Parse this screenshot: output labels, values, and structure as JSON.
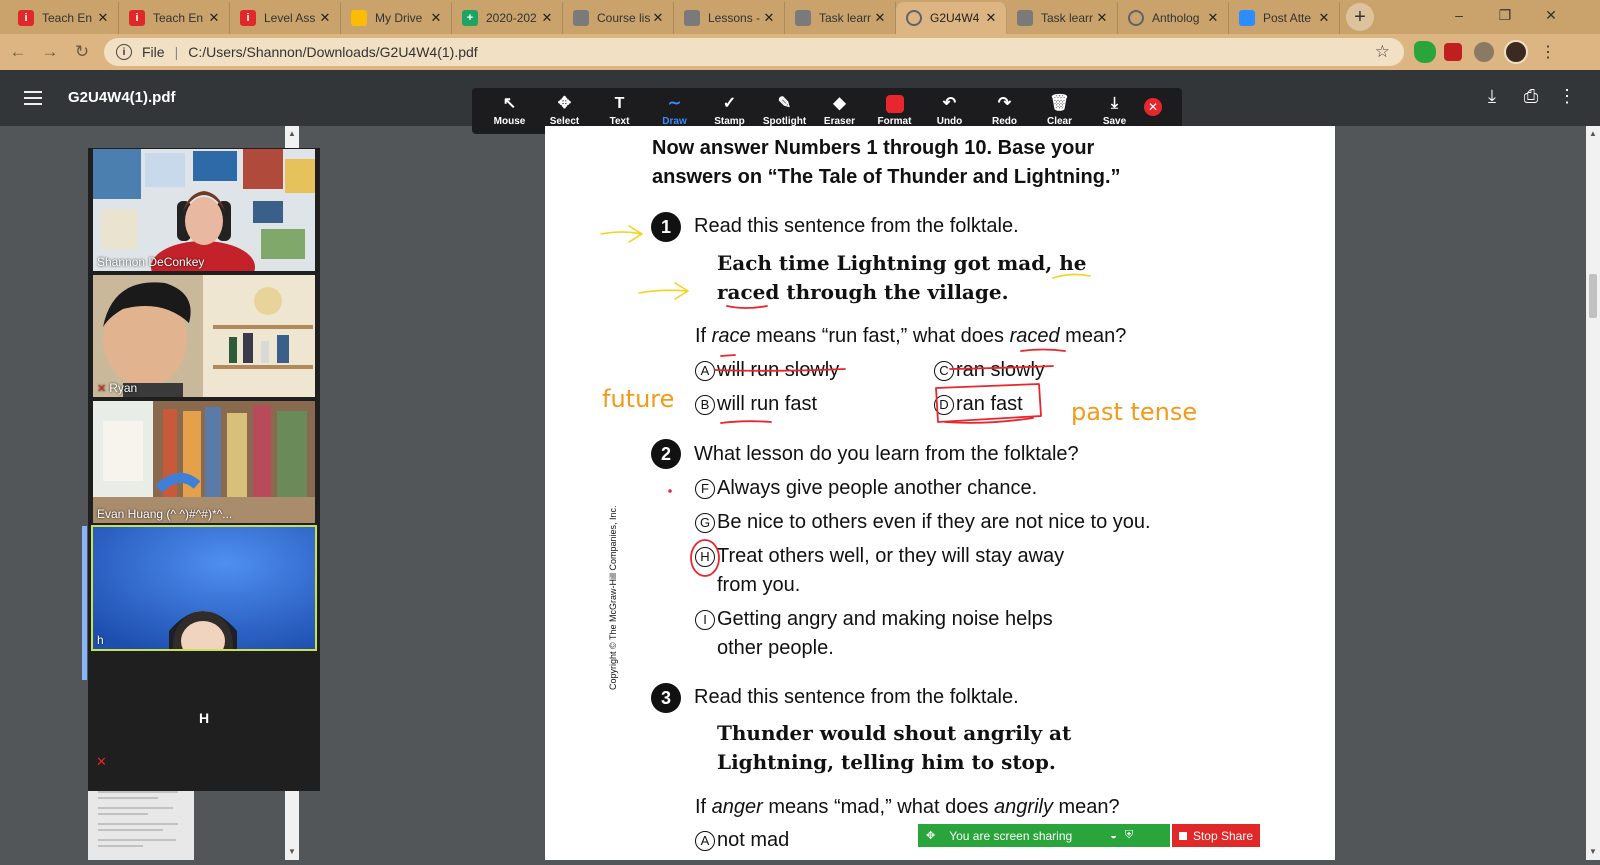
{
  "browser": {
    "tabs": [
      {
        "label": "Teach En",
        "icon": "i",
        "color": "#e02828"
      },
      {
        "label": "Teach En",
        "icon": "i",
        "color": "#e02828"
      },
      {
        "label": "Level Ass",
        "icon": "i",
        "color": "#e02828"
      },
      {
        "label": "My Drive",
        "icon": "drive",
        "color": "#fbbc04"
      },
      {
        "label": "2020-202",
        "icon": "+",
        "color": "#1ea362"
      },
      {
        "label": "Course lis",
        "icon": "course",
        "color": "#7a7a7a"
      },
      {
        "label": "Lessons -",
        "icon": "course",
        "color": "#7a7a7a"
      },
      {
        "label": "Task learr",
        "icon": "course",
        "color": "#7a7a7a"
      },
      {
        "label": "G2U4W4",
        "icon": "globe",
        "color": "#5f6368"
      },
      {
        "label": "Task learr",
        "icon": "course",
        "color": "#7a7a7a"
      },
      {
        "label": "Antholog",
        "icon": "globe",
        "color": "#5f6368"
      },
      {
        "label": "Post Atte",
        "icon": "zoom",
        "color": "#2d8cff"
      }
    ],
    "active_tab": 8,
    "tab_close": "✕",
    "new_tab": "+",
    "window_controls": [
      "–",
      "❐",
      "✕"
    ],
    "address": {
      "scheme": "File",
      "url": "C:/Users/Shannon/Downloads/G2U4W4(1).pdf"
    }
  },
  "pdf_viewer": {
    "title": "G2U4W4(1).pdf"
  },
  "annotation_toolbar": {
    "tools": [
      {
        "label": "Mouse",
        "icon": "↖"
      },
      {
        "label": "Select",
        "icon": "✥"
      },
      {
        "label": "Text",
        "icon": "T"
      },
      {
        "label": "Draw",
        "icon": "∼"
      },
      {
        "label": "Stamp",
        "icon": "✓"
      },
      {
        "label": "Spotlight",
        "icon": "✎"
      },
      {
        "label": "Eraser",
        "icon": "◆"
      },
      {
        "label": "Format",
        "icon": "■"
      },
      {
        "label": "Undo",
        "icon": "↶"
      },
      {
        "label": "Redo",
        "icon": "↷"
      },
      {
        "label": "Clear",
        "icon": "🗑"
      },
      {
        "label": "Save",
        "icon": "⤓"
      }
    ],
    "active_tool": "Draw",
    "format_color": "#e8262d"
  },
  "zoom_panel": {
    "participants": [
      {
        "name": "Shannon DeConkey",
        "muted": false
      },
      {
        "name": "Ryan",
        "muted": true
      },
      {
        "name": "Evan Huang (^ ^)#^#)*^...",
        "muted": false
      },
      {
        "name": "h",
        "muted": false
      }
    ],
    "placeholder_name": "H"
  },
  "document": {
    "heading_line1": "Now answer Numbers 1 through 10. Base your",
    "heading_line2": "answers on “The Tale of Thunder and Lightning.”",
    "q1": {
      "number": "1",
      "prompt": "Read this sentence from the folktale.",
      "quote_line1a": "Each time Lightning got mad, ",
      "quote_line1b": "he",
      "quote_line2a": "raced",
      "quote_line2b": " through the village.",
      "question": {
        "pre": "If ",
        "w1": "race",
        "mid": " means “run fast,” what does ",
        "w2": "raced",
        "post": " mean?"
      },
      "options": [
        {
          "letter": "A",
          "text": "will run slowly"
        },
        {
          "letter": "C",
          "text": "ran slowly"
        },
        {
          "letter": "B",
          "text": "will run fast"
        },
        {
          "letter": "D",
          "text": "ran fast"
        }
      ]
    },
    "q2": {
      "number": "2",
      "prompt": "What lesson do you learn from the folktale?",
      "options": [
        {
          "letter": "F",
          "text": "Always give people another chance."
        },
        {
          "letter": "G",
          "text": "Be nice to others even if they are not nice to you."
        },
        {
          "letter": "H",
          "text": "Treat others well, or they will stay away",
          "text2": "from you."
        },
        {
          "letter": "I",
          "text": "Getting angry and making noise helps",
          "text2": "other people."
        }
      ]
    },
    "q3": {
      "number": "3",
      "prompt": "Read this sentence from the folktale.",
      "quote_line1": "Thunder would shout angrily at",
      "quote_line2": "Lightning, telling him to stop.",
      "question": {
        "pre": "If ",
        "w1": "anger",
        "mid": " means “mad,” what does ",
        "w2": "angrily",
        "post": " mean?"
      },
      "options": [
        {
          "letter": "A",
          "text": "not mad"
        }
      ]
    },
    "copyright": "Copyright © The McGraw-Hill Companies, Inc.",
    "handwriting": {
      "note_left": "future",
      "note_right": "past tense",
      "pen_red": "#e8262d",
      "pen_yellow": "#f5d21c",
      "pen_orange": "#f39a1a"
    }
  },
  "share_bar": {
    "status": "You are screen sharing",
    "stop_label": "Stop Share"
  }
}
